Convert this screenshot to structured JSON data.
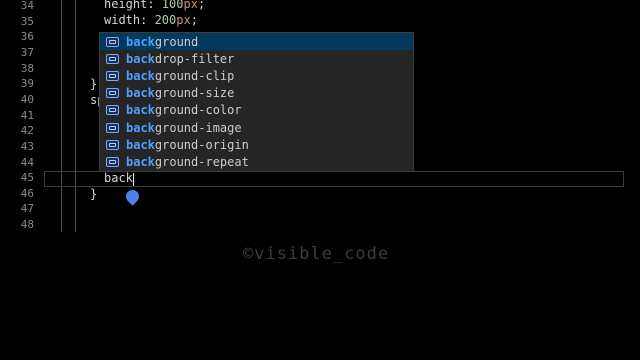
{
  "editor": {
    "line_numbers": [
      "34",
      "35",
      "36",
      "37",
      "38",
      "39",
      "40",
      "41",
      "42",
      "43",
      "44",
      "45",
      "46",
      "47",
      "48"
    ],
    "lines": {
      "l34": {
        "prop": "height: ",
        "num": "100",
        "unit": "px",
        "end": ";"
      },
      "l35": {
        "prop": "width: ",
        "num": "200",
        "unit": "px",
        "end": ";"
      },
      "l39": "}",
      "l40": "sp",
      "l45": "back",
      "l46": "}"
    }
  },
  "suggestions": {
    "typed": "back",
    "items": [
      {
        "match": "back",
        "rest": "ground",
        "icon": "property-icon"
      },
      {
        "match": "back",
        "rest": "drop-filter",
        "icon": "property-icon"
      },
      {
        "match": "back",
        "rest": "ground-clip",
        "icon": "property-icon"
      },
      {
        "match": "back",
        "rest": "ground-size",
        "icon": "property-icon"
      },
      {
        "match": "back",
        "rest": "ground-color",
        "icon": "property-icon"
      },
      {
        "match": "back",
        "rest": "ground-image",
        "icon": "property-icon"
      },
      {
        "match": "back",
        "rest": "ground-origin",
        "icon": "property-icon"
      },
      {
        "match": "back",
        "rest": "ground-repeat",
        "icon": "property-icon"
      }
    ],
    "selected_index": 0
  },
  "watermark": "©visible_code",
  "colors": {
    "background": "#000000",
    "suggest_bg": "#252526",
    "selected_bg": "#04395e",
    "match": "#4da0ff",
    "handle": "#4f7fe8"
  }
}
